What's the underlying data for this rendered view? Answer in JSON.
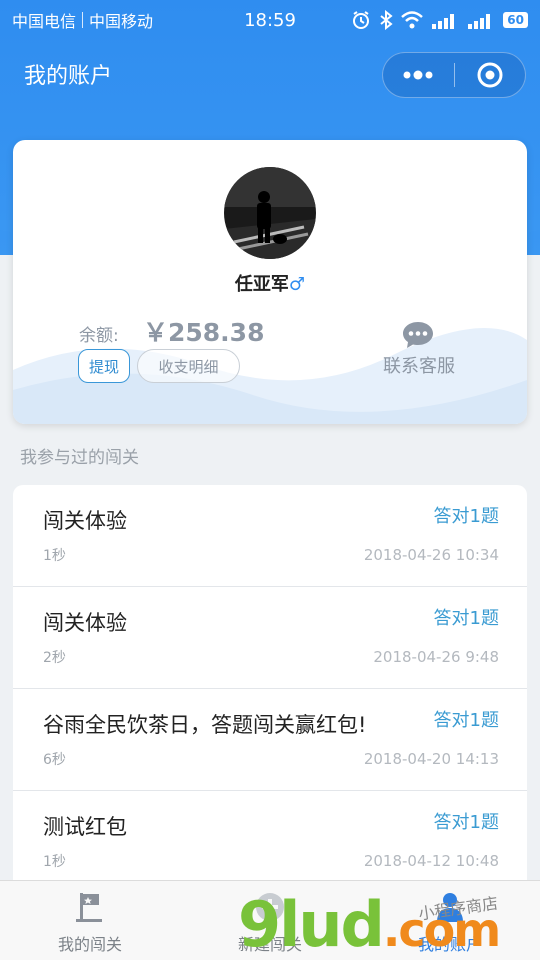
{
  "status_bar": {
    "carrier1": "中国电信",
    "carrier2": "中国移动",
    "time": "18:59",
    "battery": "60"
  },
  "nav": {
    "title": "我的账户"
  },
  "account": {
    "username": "任亚军",
    "gender_symbol": "♂",
    "balance_label": "余额:",
    "balance_value": "￥258.38",
    "withdraw_label": "提现",
    "detail_label": "收支明细",
    "support_label": "联系客服"
  },
  "section_title": "我参与过的闯关",
  "challenges": [
    {
      "title": "闯关体验",
      "score": "答对1题",
      "duration": "1秒",
      "date": "2018-04-26 10:34"
    },
    {
      "title": "闯关体验",
      "score": "答对1题",
      "duration": "2秒",
      "date": "2018-04-26 9:48"
    },
    {
      "title": "谷雨全民饮茶日，答题闯关赢红包!",
      "score": "答对1题",
      "duration": "6秒",
      "date": "2018-04-20 14:13"
    },
    {
      "title": "测试红包",
      "score": "答对1题",
      "duration": "1秒",
      "date": "2018-04-12 10:48"
    }
  ],
  "tabbar": {
    "tabs": [
      {
        "label": "我的闯关",
        "icon": "flag-icon"
      },
      {
        "label": "新建闯关",
        "icon": "add-icon"
      },
      {
        "label": "我的账户",
        "icon": "user-icon"
      }
    ]
  },
  "watermark": {
    "main_a": "9lud",
    "main_b": ".com",
    "sub": "小程序商店"
  },
  "colors": {
    "primary": "#2f8df0",
    "score": "#3a9bd2",
    "muted": "#8d97a4"
  }
}
